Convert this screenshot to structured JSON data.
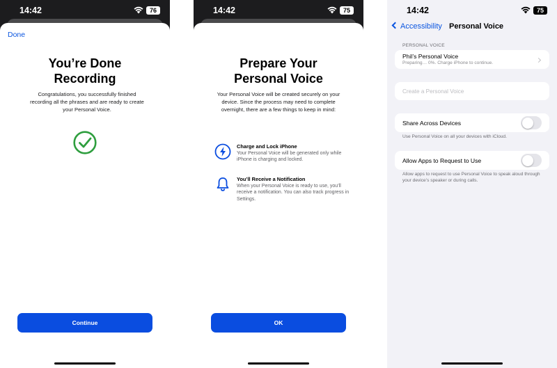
{
  "status_bar": {
    "screen1": {
      "time": "14:42",
      "battery": "76"
    },
    "screen2": {
      "time": "14:42",
      "battery": "75"
    },
    "screen3": {
      "time": "14:42",
      "battery": "75"
    }
  },
  "screen1": {
    "done_label": "Done",
    "title": "You’re Done Recording",
    "body": "Congratulations, you successfully finished recording all the phrases and are ready to create your Personal Voice.",
    "continue_label": "Continue"
  },
  "screen2": {
    "title": "Prepare Your Personal Voice",
    "body": "Your Personal Voice will be created securely on your device. Since the process may need to complete overnight, there are a few things to keep in mind:",
    "items": [
      {
        "title": "Charge and Lock iPhone",
        "description": "Your Personal Voice will be generated only while iPhone is charging and locked.",
        "icon": "lightning-icon"
      },
      {
        "title": "You’ll Receive a Notification",
        "description": "When your Personal Voice is ready to use, you’ll receive a notification. You can also track progress in Settings.",
        "icon": "bell-icon"
      }
    ],
    "ok_label": "OK"
  },
  "screen3": {
    "back_label": "Accessibility",
    "nav_title": "Personal Voice",
    "section_header": "PERSONAL VOICE",
    "voice_name": "Phil’s Personal Voice",
    "voice_status": "Preparing… 0%. Charge iPhone to continue.",
    "create_placeholder": "Create a Personal Voice",
    "share_label": "Share Across Devices",
    "share_footnote": "Use Personal Voice on all your devices with iCloud.",
    "allow_label": "Allow Apps to Request to Use",
    "allow_footnote": "Allow apps to request to use Personal Voice to speak aloud through your device’s speaker or during calls.",
    "share_enabled": false,
    "allow_enabled": false
  },
  "colors": {
    "accent": "#0a4de0",
    "success": "#2e9e3e",
    "settings_background": "#f2f2f7"
  }
}
